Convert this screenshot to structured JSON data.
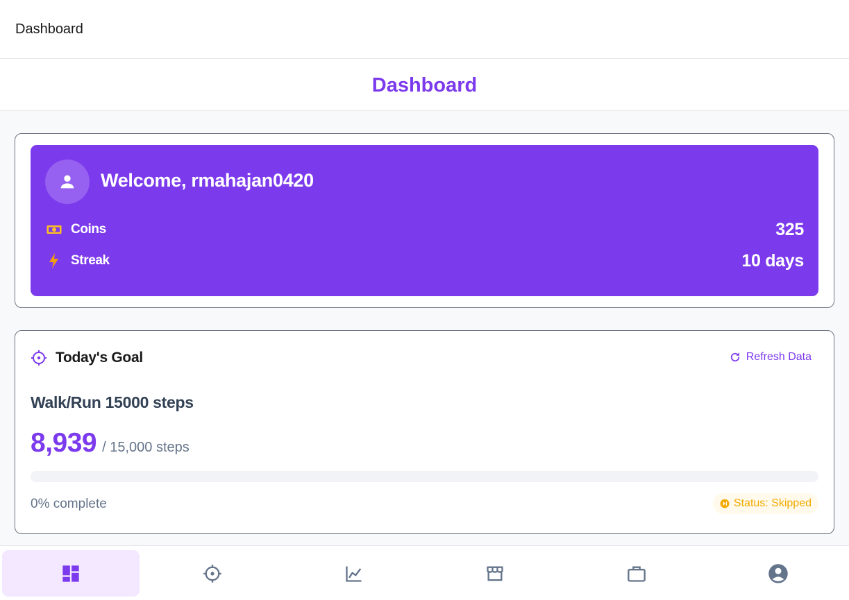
{
  "app": {
    "top_title": "Dashboard",
    "page_title": "Dashboard"
  },
  "welcome": {
    "greeting": "Welcome, rmahajan0420",
    "stats": [
      {
        "label": "Coins",
        "value": "325",
        "icon": "cash-icon"
      },
      {
        "label": "Streak",
        "value": "10 days",
        "icon": "lightning-icon"
      }
    ]
  },
  "goal": {
    "header": "Today's Goal",
    "refresh_label": "Refresh Data",
    "description": "Walk/Run 15000 steps",
    "current": "8,939",
    "target_text": "/ 15,000 steps",
    "progress_fraction": 0,
    "percent_text": "0% complete",
    "status_text": "Status: Skipped"
  },
  "nav": {
    "items": [
      {
        "name": "dashboard",
        "icon": "dashboard-icon",
        "active": true
      },
      {
        "name": "goals",
        "icon": "target-icon",
        "active": false
      },
      {
        "name": "stats",
        "icon": "chart-icon",
        "active": false
      },
      {
        "name": "store",
        "icon": "store-icon",
        "active": false
      },
      {
        "name": "inventory",
        "icon": "briefcase-icon",
        "active": false
      },
      {
        "name": "profile",
        "icon": "account-circle-icon",
        "active": false
      }
    ]
  },
  "colors": {
    "accent": "#7c3aed",
    "coins_icon": "#fbbf24",
    "streak_icon": "#f59e0b",
    "status_skipped": "#f2a900",
    "nav_inactive": "#64748b"
  }
}
